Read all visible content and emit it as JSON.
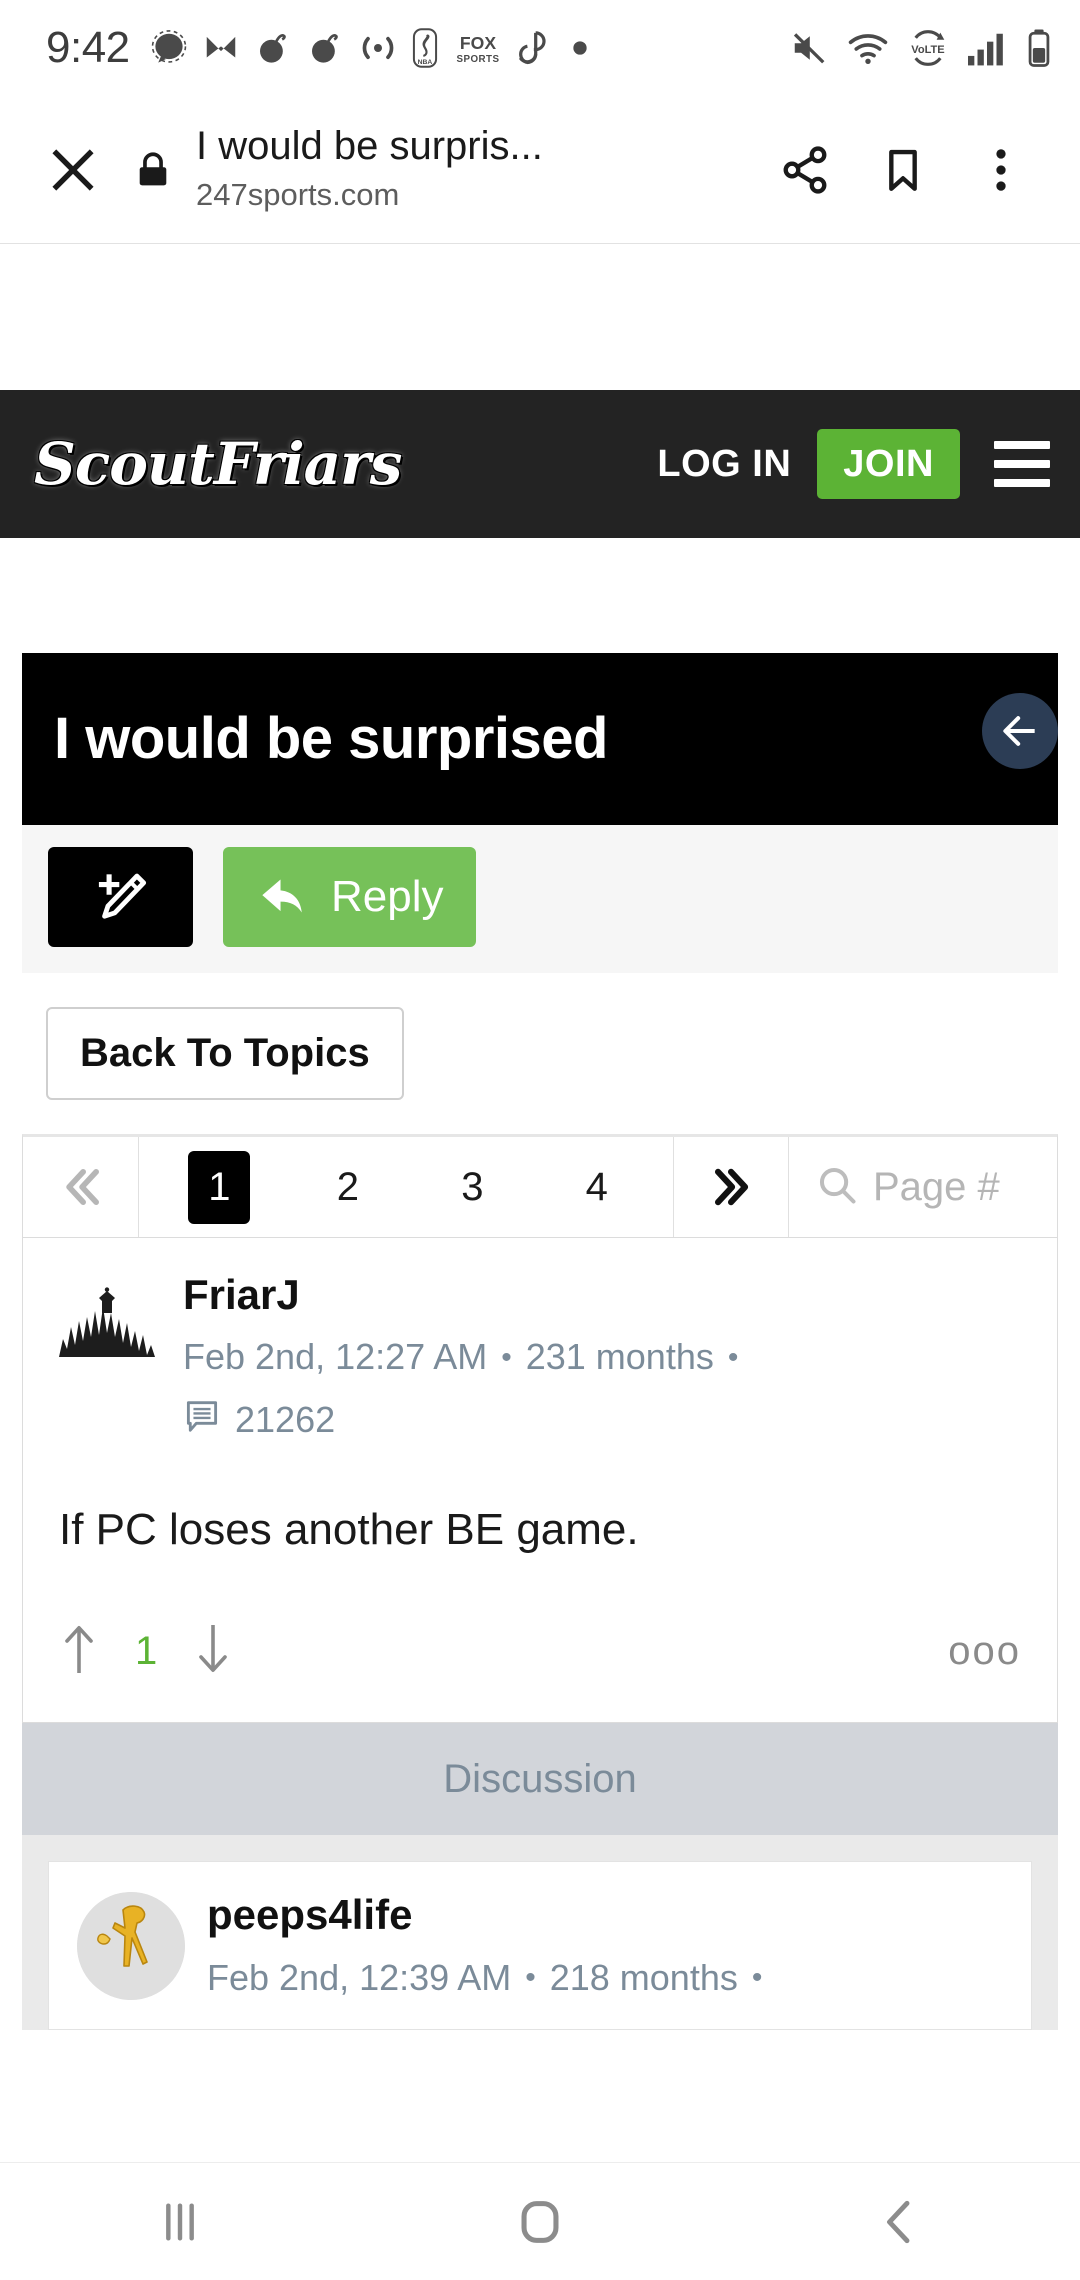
{
  "status_bar": {
    "clock": "9:42",
    "left_icons": [
      "messages-icon",
      "mail-icon",
      "podcast-app-icon",
      "podcast-app-icon-2",
      "broadcast-icon",
      "nba-icon",
      "fox-sports-icon",
      "link-app-icon",
      "dot-icon"
    ],
    "right_icons": [
      "mute-icon",
      "wifi-icon",
      "volte-icon",
      "signal-icon",
      "battery-icon"
    ],
    "volte_label": "VoLTE"
  },
  "browser": {
    "close_label": "×",
    "lock_icon": "lock-icon",
    "page_title": "I would be surpris...",
    "page_url": "247sports.com",
    "share_icon": "share-icon",
    "bookmark_icon": "bookmark-icon",
    "overflow_icon": "more-vertical-icon"
  },
  "site_header": {
    "logo_text": "ScoutFriars",
    "login_label": "LOG IN",
    "join_label": "JOIN",
    "menu_icon": "hamburger-menu-icon",
    "join_color": "#5cb335",
    "background": "#232323"
  },
  "thread": {
    "back_to_top_icon": "arrow-left-icon",
    "title": "I would be surprised",
    "compose_icon": "compose-pencil-icon",
    "reply_label": "Reply",
    "reply_icon": "reply-arrow-icon",
    "back_to_topics_label": "Back To Topics"
  },
  "pagination": {
    "first_icon": "double-chevron-left-icon",
    "next_icon": "double-chevron-right-icon",
    "pages": [
      "1",
      "2",
      "3",
      "4"
    ],
    "active_page": "1",
    "search_icon": "search-icon",
    "search_placeholder": "Page #"
  },
  "posts": [
    {
      "avatar_icon": "skyline-avatar",
      "username": "FriarJ",
      "date": "Feb 2nd, 12:27 AM",
      "tenure": "231 months",
      "post_count_icon": "comment-icon",
      "post_count": "21262",
      "body": "If PC loses another BE game.",
      "upvote_icon": "arrow-up-icon",
      "vote_count": "1",
      "downvote_icon": "arrow-down-icon",
      "more_icon": "more-horizontal-icon",
      "more_label": "ooo"
    }
  ],
  "discussion": {
    "label": "Discussion"
  },
  "replies": [
    {
      "avatar_icon": "golden-figure-avatar",
      "username": "peeps4life",
      "date": "Feb 2nd, 12:39 AM",
      "tenure": "218 months"
    }
  ],
  "nav_bar": {
    "recents_icon": "recents-icon",
    "home_icon": "home-icon",
    "back_icon": "back-chevron-icon"
  },
  "colors": {
    "accent_green": "#5cb335",
    "reply_green": "#76c159",
    "header_dark": "#232323",
    "meta_blue_grey": "#7b8b99"
  }
}
